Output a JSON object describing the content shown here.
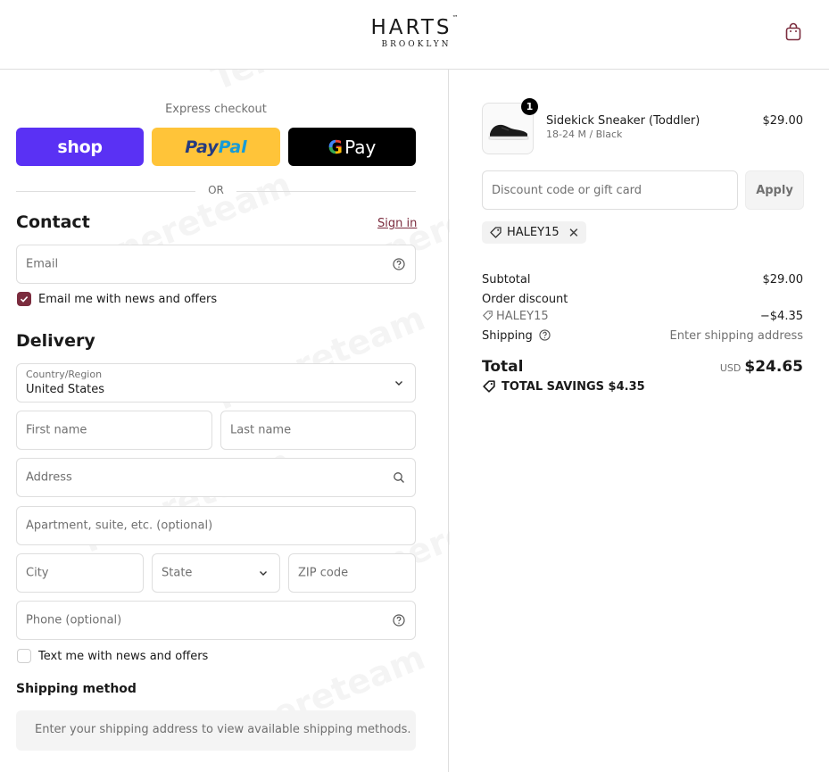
{
  "header": {
    "logo_main": "HARTS",
    "logo_tm": "™",
    "logo_sub": "BROOKLYN",
    "cart_icon": "shopping-bag-icon"
  },
  "express": {
    "label": "Express checkout",
    "shop_label": "shop",
    "paypal_label_a": "Pay",
    "paypal_label_b": "Pal",
    "gpay_g": "G",
    "gpay_label": "Pay",
    "or_label": "OR"
  },
  "contact": {
    "title": "Contact",
    "sign_in": "Sign in",
    "email_placeholder": "Email",
    "newsletter_label": "Email me with news and offers",
    "newsletter_checked": true
  },
  "delivery": {
    "title": "Delivery",
    "country_label": "Country/Region",
    "country_value": "United States",
    "first_name_placeholder": "First name",
    "last_name_placeholder": "Last name",
    "address_placeholder": "Address",
    "apartment_placeholder": "Apartment, suite, etc. (optional)",
    "city_placeholder": "City",
    "state_placeholder": "State",
    "zip_placeholder": "ZIP code",
    "phone_placeholder": "Phone (optional)",
    "sms_label": "Text me with news and offers",
    "sms_checked": false
  },
  "shipping": {
    "title": "Shipping method",
    "message": "Enter your shipping address to view available shipping methods."
  },
  "order": {
    "item": {
      "quantity": "1",
      "name": "Sidekick Sneaker (Toddler)",
      "variant": "18-24 M / Black",
      "price": "$29.00"
    },
    "discount_placeholder": "Discount code or gift card",
    "apply_label": "Apply",
    "applied_code": "HALEY15",
    "subtotal_label": "Subtotal",
    "subtotal_value": "$29.00",
    "order_discount_label": "Order discount",
    "discount_code": "HALEY15",
    "discount_value": "−$4.35",
    "shipping_label": "Shipping",
    "shipping_value": "Enter shipping address",
    "total_label": "Total",
    "currency": "USD",
    "total_value": "$24.65",
    "savings_label": "TOTAL SAVINGS",
    "savings_value": "$4.35"
  },
  "watermark": "Tenereteam",
  "colors": {
    "accent": "#7b2c3e",
    "shop": "#5a31f4",
    "paypal": "#ffc439",
    "gpay": "#000000",
    "border": "#dedede"
  }
}
